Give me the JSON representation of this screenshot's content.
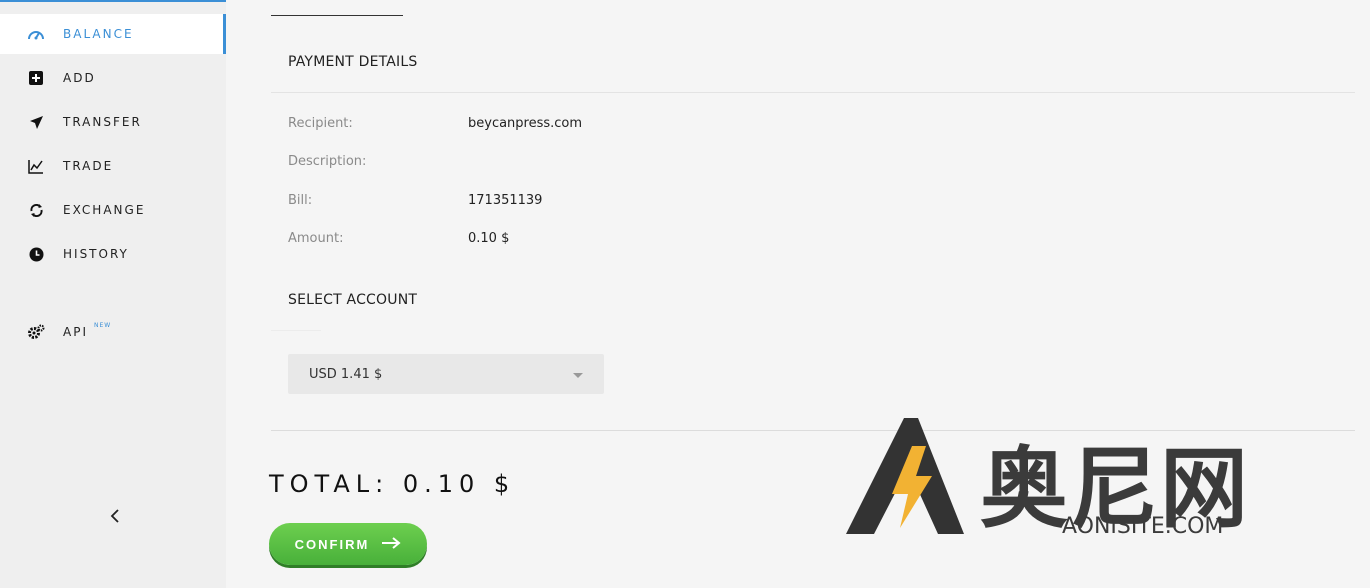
{
  "sidebar": {
    "items": [
      {
        "label": "BALANCE",
        "icon": "dashboard-icon",
        "active": true
      },
      {
        "label": "ADD",
        "icon": "plus-square-icon"
      },
      {
        "label": "TRANSFER",
        "icon": "paper-plane-icon"
      },
      {
        "label": "TRADE",
        "icon": "chart-line-icon"
      },
      {
        "label": "EXCHANGE",
        "icon": "refresh-icon"
      },
      {
        "label": "HISTORY",
        "icon": "clock-icon"
      },
      {
        "label": "API",
        "icon": "gears-icon",
        "badge": "NEW"
      }
    ],
    "collapse_icon": "chevron-left-icon"
  },
  "payment": {
    "title": "PAYMENT DETAILS",
    "rows": [
      {
        "label": "Recipient:",
        "value": "beycanpress.com"
      },
      {
        "label": "Description:",
        "value": ""
      },
      {
        "label": "Bill:",
        "value": "171351139"
      },
      {
        "label": "Amount:",
        "value": "0.10 $"
      }
    ]
  },
  "account": {
    "title": "SELECT ACCOUNT",
    "selected": "USD 1.41 $"
  },
  "total": "TOTAL: 0.10 $",
  "confirm": {
    "label": "CONFIRM",
    "icon": "arrow-right-icon"
  },
  "watermark": {
    "text": "奥尼网",
    "sub": "AONISITE.COM"
  },
  "colors": {
    "accent": "#3b8fd6",
    "confirm": "#55bf3f"
  }
}
